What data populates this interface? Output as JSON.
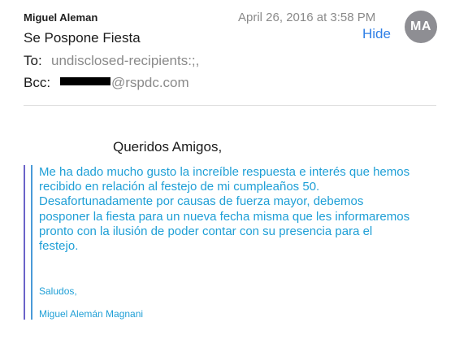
{
  "header": {
    "sender_name": "Miguel Aleman",
    "date": "April 26, 2016 at 3:58 PM",
    "hide_label": "Hide",
    "avatar_initials": "MA",
    "subject": "Se Pospone Fiesta",
    "to_label": "To:",
    "to_value": "undisclosed-recipients:;,",
    "bcc_label": "Bcc:",
    "bcc_value": "@rspdc.com"
  },
  "body": {
    "greeting": "Queridos Amigos,",
    "quote_lines": [
      "Me ha dado mucho gusto la increíble respuesta e interés que hemos",
      "recibido en relación al festejo de mi cumpleaños 50.",
      "Desafortunadamente por causas de fuerza mayor, debemos",
      "posponer la fiesta para un nueva fecha misma que les informaremos",
      "pronto con la ilusión de poder contar con su presencia para el",
      "festejo."
    ],
    "signoff": "Saludos,",
    "signature": "Miguel Alemán Magnani"
  },
  "colors": {
    "link": "#2f7fe6",
    "quote_text": "#1f9fd6",
    "quote_bar_outer": "#6b63c8",
    "quote_bar_inner": "#4a9ad8",
    "avatar_bg": "#8e8e93"
  }
}
